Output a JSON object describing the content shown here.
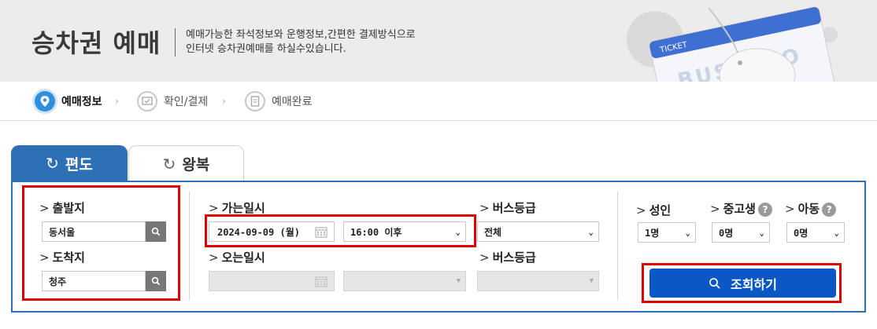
{
  "header": {
    "title": "승차권 예매",
    "description_line1": "예매가능한 좌석정보와 운행정보,간편한 결제방식으로",
    "description_line2": "인터넷 승차권예매를 하실수있습니다.",
    "art_ticket_label": "TICKET",
    "art_card_text": "BUSTAGO"
  },
  "steps": [
    {
      "label": "예매정보",
      "state": "active"
    },
    {
      "label": "확인/결제",
      "state": "inactive"
    },
    {
      "label": "예매완료",
      "state": "inactive"
    }
  ],
  "tabs": [
    {
      "label": "편도",
      "active": true
    },
    {
      "label": "왕복",
      "active": false
    }
  ],
  "route": {
    "departure_label": "출발지",
    "departure_value": "동서울",
    "arrival_label": "도착지",
    "arrival_value": "청주"
  },
  "schedule": {
    "go_date_label": "가는일시",
    "go_date_value": "2024-09-09 (월)",
    "go_time_value": "16:00 이후",
    "go_grade_label": "버스등급",
    "go_grade_value": "전체",
    "return_date_label": "오는일시",
    "return_grade_label": "버스등급"
  },
  "passengers": {
    "adult_label": "성인",
    "adult_value": "1명",
    "student_label": "중고생",
    "student_value": "0명",
    "child_label": "아동",
    "child_value": "0명",
    "help_symbol": "?"
  },
  "search_button": {
    "label": "조회하기"
  },
  "colors": {
    "primary": "#2d70b6",
    "button": "#0b57c4",
    "highlight": "#e00000",
    "step_active": "#2f8fdc"
  }
}
